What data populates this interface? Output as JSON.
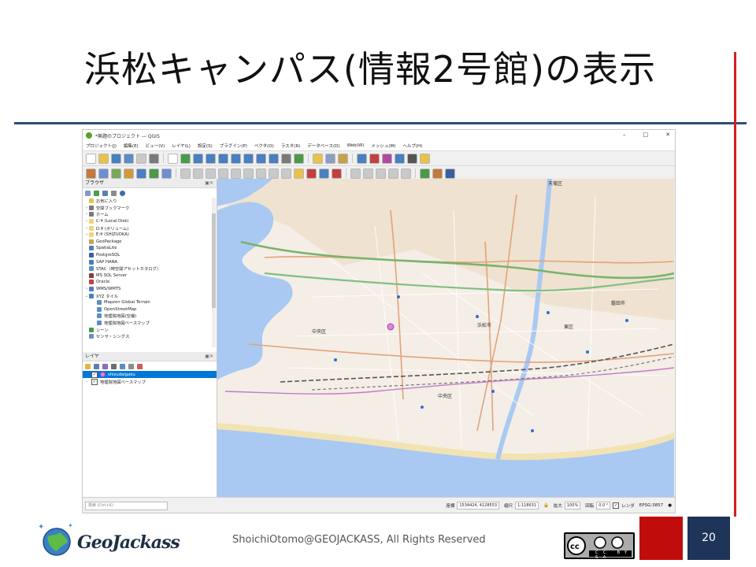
{
  "slide": {
    "title": "浜松キャンパス(情報2号館)の表示",
    "footer_text": "ShoichiOtomo@GEOJACKASS, All Rights Reserved",
    "page_number": "20",
    "logo_text": "GeoJackass",
    "license_badge": "CC BY SA",
    "colors": {
      "title_rule": "#2d4f78",
      "accent_red": "#d81f1f",
      "page_box": "#1e3459"
    }
  },
  "qgis": {
    "window_title": "*無題のプロジェクト — QGIS",
    "window_controls": [
      "–",
      "□",
      "✕"
    ],
    "menu": [
      "プロジェクト(J)",
      "編集(E)",
      "ビュー(V)",
      "レイヤ(L)",
      "設定(S)",
      "プラグイン(P)",
      "ベクタ(O)",
      "ラスタ(R)",
      "データベース(D)",
      "Web(W)",
      "メッシュ(M)",
      "ヘルプ(H)"
    ],
    "browser": {
      "title": "ブラウザ",
      "items": [
        {
          "label": "お気に入り",
          "indent": 0,
          "icon": "star-icon",
          "arrow": ""
        },
        {
          "label": "空間ブックマーク",
          "indent": 0,
          "icon": "bookmark-icon",
          "arrow": "›"
        },
        {
          "label": "ホーム",
          "indent": 0,
          "icon": "home-icon",
          "arrow": "›"
        },
        {
          "label": "C:¥ (Local Disk)",
          "indent": 0,
          "icon": "folder-icon",
          "arrow": "›"
        },
        {
          "label": "D:¥ (ボリューム)",
          "indent": 0,
          "icon": "folder-icon",
          "arrow": "›"
        },
        {
          "label": "E:¥ (SHIZUOKA)",
          "indent": 0,
          "icon": "folder-icon",
          "arrow": "›"
        },
        {
          "label": "GeoPackage",
          "indent": 0,
          "icon": "geopackage-icon",
          "arrow": ""
        },
        {
          "label": "SpatiaLite",
          "indent": 0,
          "icon": "spatialite-icon",
          "arrow": ""
        },
        {
          "label": "PostgreSQL",
          "indent": 0,
          "icon": "postgresql-icon",
          "arrow": ""
        },
        {
          "label": "SAP HANA",
          "indent": 0,
          "icon": "saphana-icon",
          "arrow": ""
        },
        {
          "label": "STAC（時空間アセットカタログ）",
          "indent": 0,
          "icon": "stac-icon",
          "arrow": ""
        },
        {
          "label": "MS SQL Server",
          "indent": 0,
          "icon": "mssql-icon",
          "arrow": ""
        },
        {
          "label": "Oracle",
          "indent": 0,
          "icon": "oracle-icon",
          "arrow": ""
        },
        {
          "label": "WMS/WMTS",
          "indent": 0,
          "icon": "wms-icon",
          "arrow": "›"
        },
        {
          "label": "XYZ タイル",
          "indent": 0,
          "icon": "xyz-icon",
          "arrow": "⌄"
        },
        {
          "label": "Mapzen Global Terrain",
          "indent": 1,
          "icon": "tile-icon",
          "arrow": ""
        },
        {
          "label": "OpenStreetMap",
          "indent": 1,
          "icon": "tile-icon",
          "arrow": ""
        },
        {
          "label": "地理院地図(空撮)",
          "indent": 1,
          "icon": "tile-icon",
          "arrow": ""
        },
        {
          "label": "地理院地図ベースマップ",
          "indent": 1,
          "icon": "tile-icon",
          "arrow": ""
        },
        {
          "label": "シーン",
          "indent": 0,
          "icon": "scene-icon",
          "arrow": ""
        },
        {
          "label": "センサ・シングス",
          "indent": 0,
          "icon": "sensor-icon",
          "arrow": ""
        }
      ]
    },
    "layers": {
      "title": "レイヤ",
      "items": [
        {
          "label": "shizudaigaku",
          "selected": true,
          "checked": true
        },
        {
          "label": "地理院地図ベースマップ",
          "selected": false,
          "checked": true
        }
      ]
    },
    "status": {
      "search_placeholder": "検索 (Ctrl+K)",
      "coordinate_label": "座標",
      "coordinate_value": "1534424, 4128553",
      "scale_label": "縮尺",
      "scale_value": "1:118631",
      "magnifier_label": "拡大",
      "magnifier_value": "100%",
      "rotation_label": "回転",
      "rotation_value": "0.0 °",
      "render_label": "レンダ",
      "crs_label": "EPSG:3857"
    },
    "map_labels": [
      "中央区",
      "浜松市",
      "東区",
      "中央区",
      "磐田市",
      "天竜区"
    ]
  }
}
